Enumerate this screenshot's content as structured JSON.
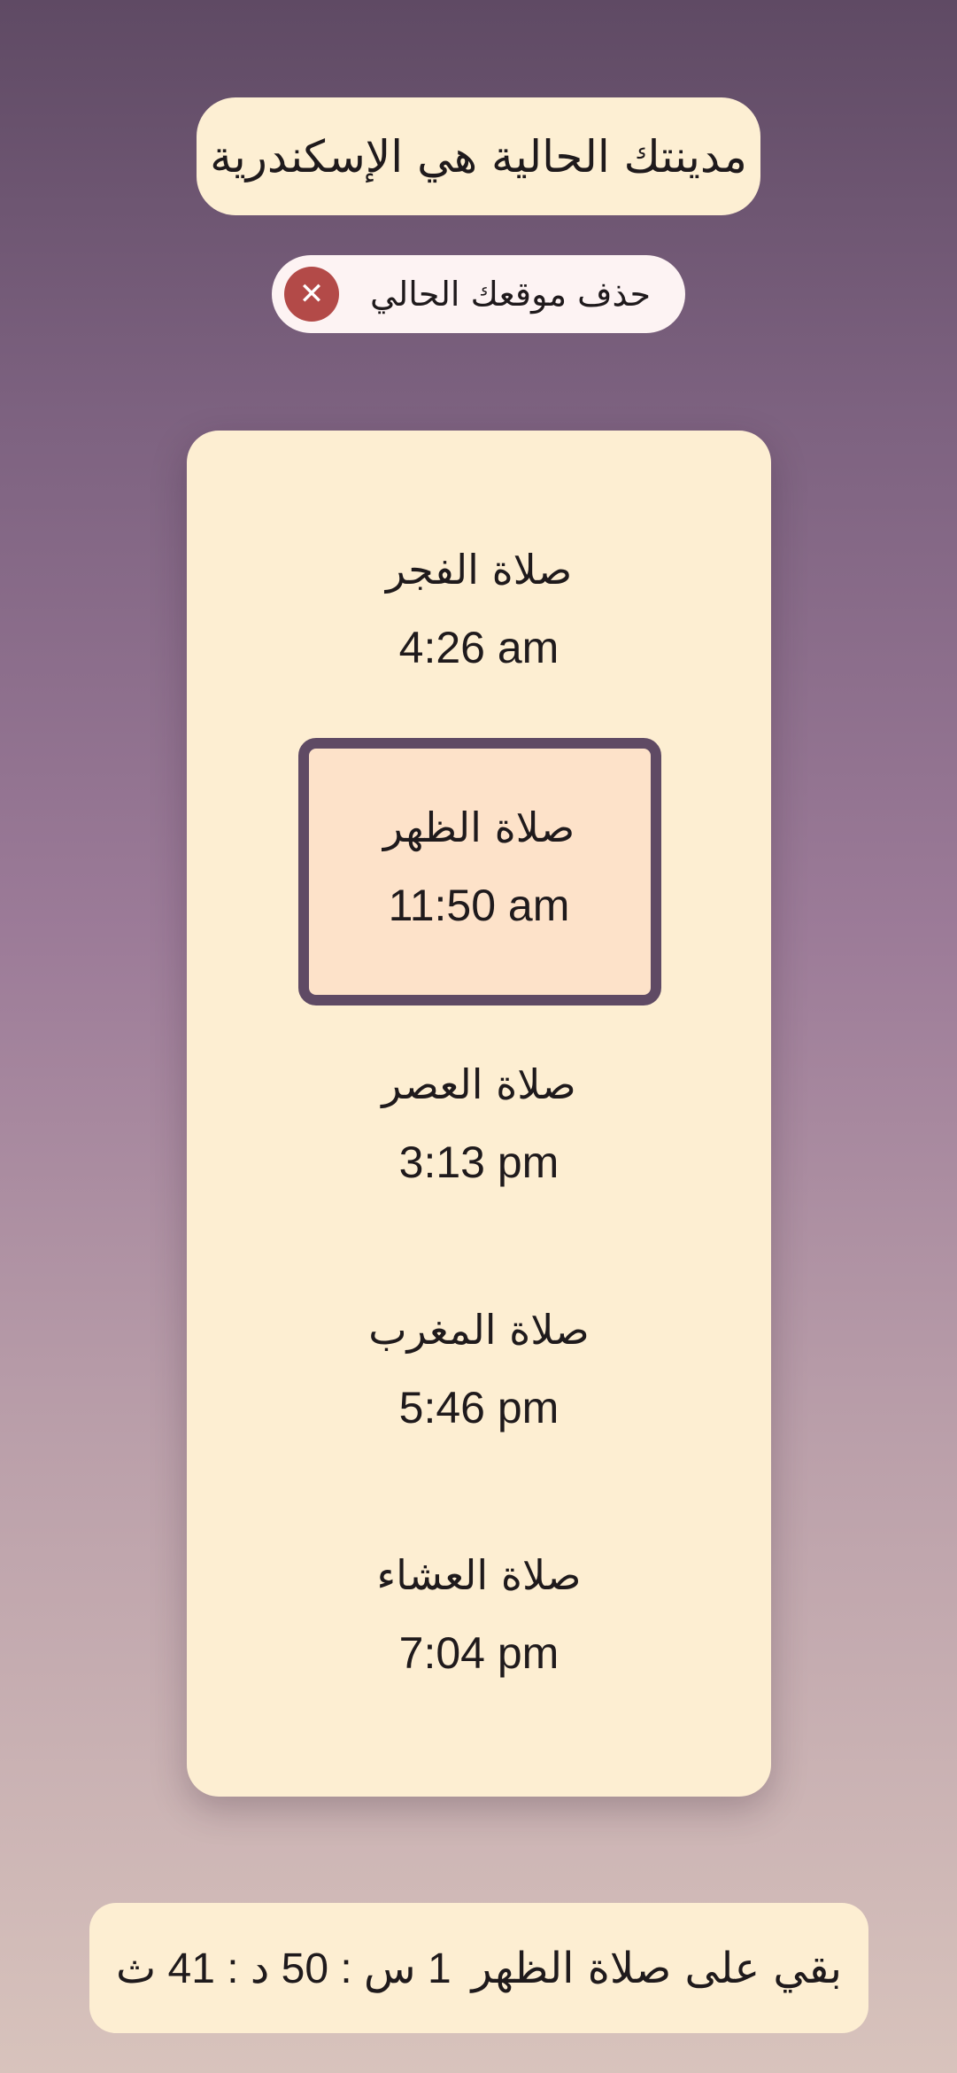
{
  "city_label": "مدينتك الحالية هي الإسكندرية",
  "remove_location": {
    "label": "حذف موقعك الحالي",
    "icon": "close-icon",
    "icon_color": "#b34a48"
  },
  "prayers": [
    {
      "name": "صلاة الفجر",
      "time": "4:26 am"
    },
    {
      "name": "صلاة الظهر",
      "time": "11:50 am",
      "current": true
    },
    {
      "name": "صلاة العصر",
      "time": "3:13 pm"
    },
    {
      "name": "صلاة المغرب",
      "time": "5:46 pm"
    },
    {
      "name": "صلاة العشاء",
      "time": "7:04 pm"
    }
  ],
  "countdown": {
    "label": "بقي على صلاة الظهر",
    "value": "1 س : 50 د : 41 ث"
  },
  "colors": {
    "accent": "#5f4a64",
    "card": "#fdeed2",
    "highlight": "#fde2c9"
  }
}
